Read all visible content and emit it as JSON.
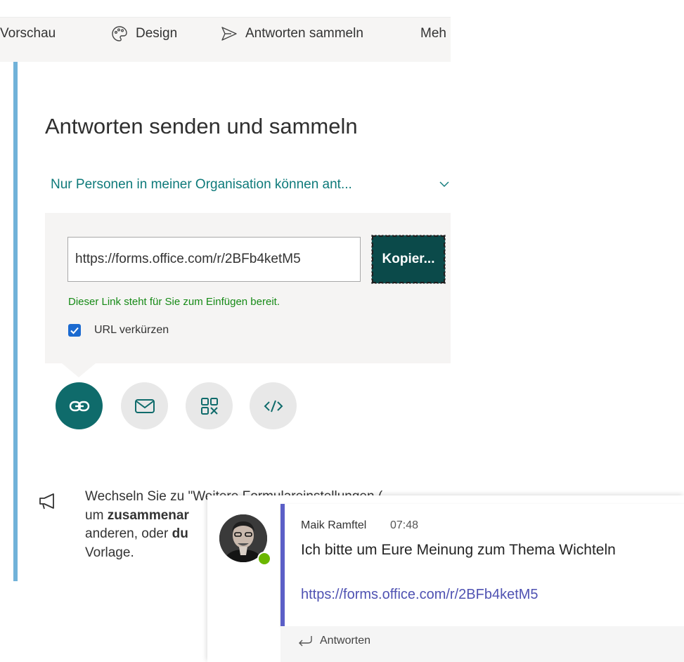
{
  "toolbar": {
    "preview_label": "Vorschau",
    "design_label": "Design",
    "collect_label": "Antworten sammeln",
    "more_label": "Meh"
  },
  "panel": {
    "title": "Antworten senden und sammeln",
    "audience_dropdown": "Nur Personen in meiner Organisation können ant...",
    "url_value": "https://forms.office.com/r/2BFb4ketM5",
    "copy_label": "Kopier...",
    "ready_text": "Dieser Link steht für Sie zum Einfügen bereit.",
    "shorten_label": "URL verkürzen",
    "shorten_checked": true,
    "share_options": [
      "link-icon",
      "mail-icon",
      "qr-code-icon",
      "embed-code-icon"
    ],
    "tip": {
      "line1": "Wechseln Sie zu \"Weitere Formulareinstellungen (",
      "line2_prefix": "um ",
      "line2_bold": "zusammenar",
      "line3_prefix": "anderen, oder ",
      "line3_bold": "du",
      "line4": "Vorlage."
    }
  },
  "teams_message": {
    "author": "Maik Ramftel",
    "time": "07:48",
    "text": "Ich bitte um Eure Meinung zum Thema Wichteln",
    "link": "https://forms.office.com/r/2BFb4ketM5",
    "reply_label": "Antworten",
    "presence": "available"
  },
  "colors": {
    "accent_bar": "#71b2d9",
    "teal": "#0f6b6b",
    "copy_button": "#0b4a4a",
    "ready_green": "#168a16",
    "teams_purple": "#5b5fc7"
  }
}
